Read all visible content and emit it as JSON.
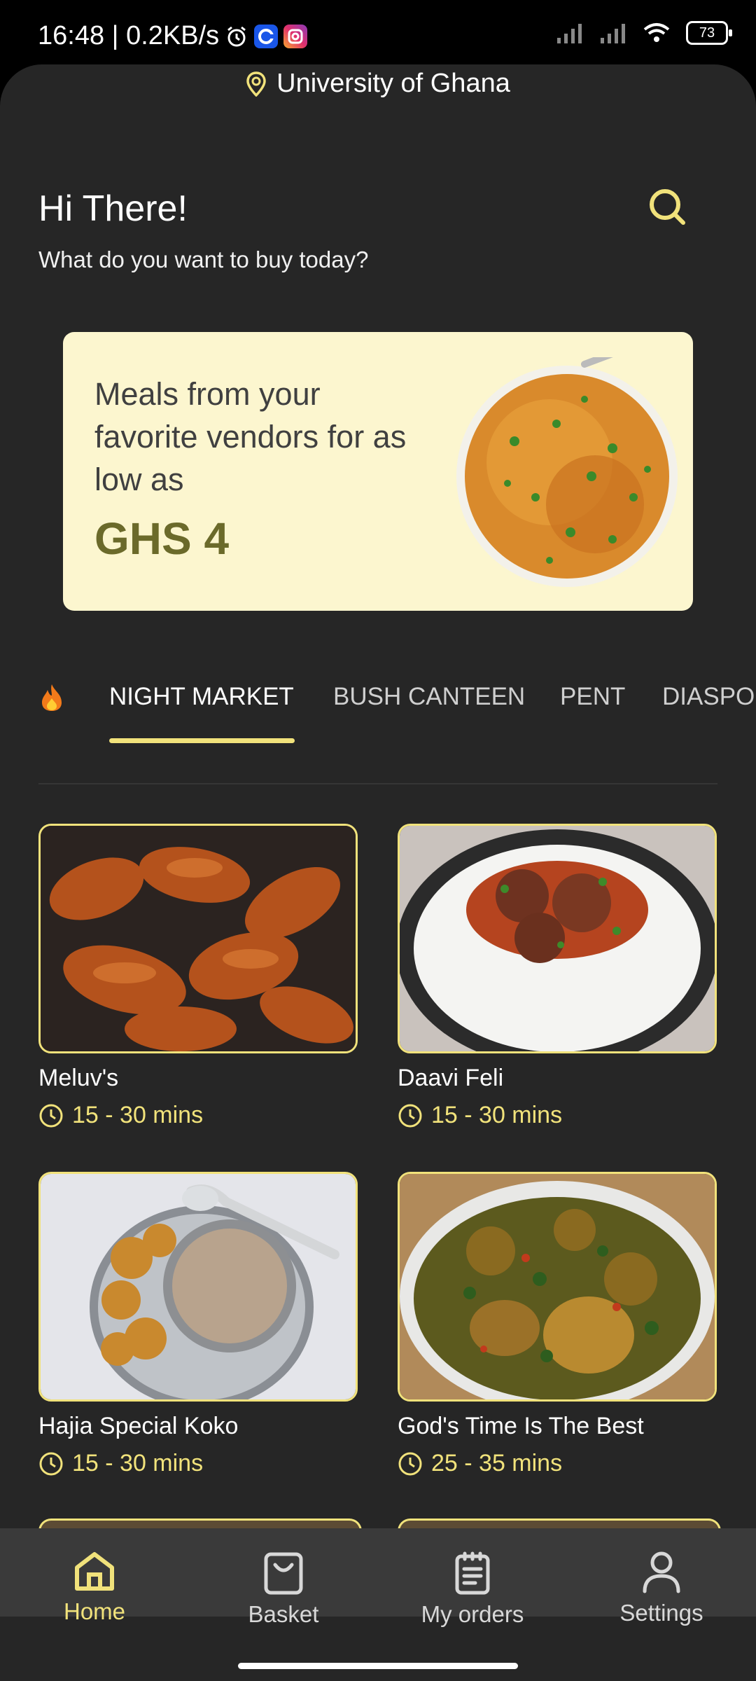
{
  "status": {
    "time_speed": "16:48 | 0.2KB/s",
    "battery": "73"
  },
  "location": "University of Ghana",
  "greeting": "Hi There!",
  "subtitle": "What do you want to buy today?",
  "banner": {
    "text": "Meals from your favorite vendors for as low as",
    "price": "GHS 4"
  },
  "tabs": [
    {
      "label": "NIGHT MARKET",
      "active": true
    },
    {
      "label": "BUSH CANTEEN",
      "active": false
    },
    {
      "label": "PENT",
      "active": false
    },
    {
      "label": "DIASPORA",
      "active": false
    }
  ],
  "vendors": [
    {
      "name": "Meluv's",
      "time": "15 - 30 mins",
      "image": "chicken-wings"
    },
    {
      "name": "Daavi Feli",
      "time": "15 - 30 mins",
      "image": "rice-meatballs"
    },
    {
      "name": "Hajia Special Koko",
      "time": "15 - 30 mins",
      "image": "koko-porridge"
    },
    {
      "name": "God's Time Is The Best",
      "time": "25 - 35 mins",
      "image": "okro-stew"
    }
  ],
  "nav": {
    "home": "Home",
    "basket": "Basket",
    "orders": "My orders",
    "settings": "Settings"
  },
  "colors": {
    "accent": "#f1e27b",
    "background": "#262626",
    "nav_background": "#3a3a3a",
    "banner_background": "#fcf6cf"
  }
}
